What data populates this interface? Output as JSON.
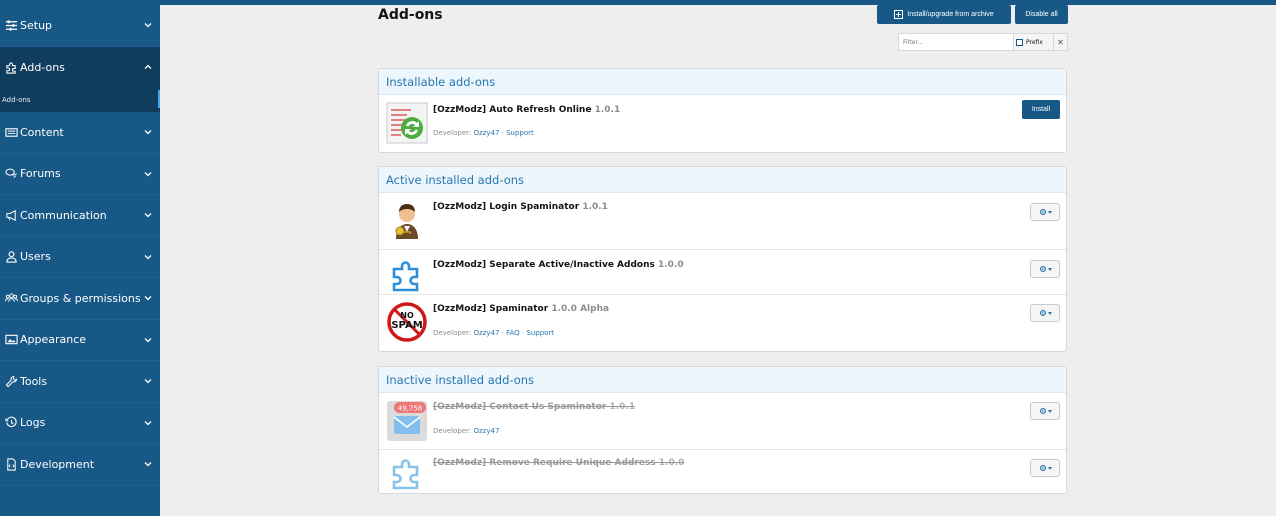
{
  "sidebar": {
    "items": [
      {
        "label": "Setup",
        "icon": "sliders-icon"
      },
      {
        "label": "Add-ons",
        "icon": "puzzle-icon"
      },
      {
        "label": "Content",
        "icon": "content-icon"
      },
      {
        "label": "Forums",
        "icon": "comments-icon"
      },
      {
        "label": "Communication",
        "icon": "megaphone-icon"
      },
      {
        "label": "Users",
        "icon": "user-icon"
      },
      {
        "label": "Groups & permissions",
        "icon": "users-icon"
      },
      {
        "label": "Appearance",
        "icon": "image-icon"
      },
      {
        "label": "Tools",
        "icon": "wrench-icon"
      },
      {
        "label": "Logs",
        "icon": "history-icon"
      },
      {
        "label": "Development",
        "icon": "file-code-icon"
      }
    ],
    "active_sub_item": "Add-ons"
  },
  "page": {
    "title": "Add-ons",
    "install_upgrade_label": "Install/upgrade from archive",
    "disable_all_label": "Disable all"
  },
  "filter": {
    "placeholder": "Filter...",
    "prefix_label": "Prefix",
    "clear_label": "✕"
  },
  "blocks": {
    "installable": {
      "header": "Installable add-ons",
      "addons": [
        {
          "title": "[OzzModz] Auto Refresh Online",
          "version": "1.0.1",
          "developer_label": "Developer:",
          "developer": "Ozzy47",
          "sep": "·",
          "support": "Support",
          "install_label": "Install"
        }
      ]
    },
    "active": {
      "header": "Active installed add-ons",
      "addons": [
        {
          "title": "[OzzModz] Login Spaminator",
          "version": "1.0.1"
        },
        {
          "title": "[OzzModz] Separate Active/Inactive Addons",
          "version": "1.0.0"
        },
        {
          "title": "[OzzModz] Spaminator",
          "version": "1.0.0 Alpha",
          "developer_label": "Developer:",
          "developer": "Ozzy47",
          "sep1": "·",
          "faq": "FAQ",
          "sep2": "·",
          "support": "Support"
        }
      ]
    },
    "inactive": {
      "header": "Inactive installed add-ons",
      "addons": [
        {
          "title": "[OzzModz] Contact Us Spaminator",
          "version": "1.0.1",
          "developer_label": "Developer:",
          "developer": "Ozzy47",
          "badge": "49,758"
        },
        {
          "title": "[OzzModz] Remove Require Unique Address",
          "version": "1.0.0"
        }
      ]
    }
  },
  "icons": {
    "nospam_top": "NO",
    "nospam_mid": "SPAM"
  },
  "colors": {
    "sidebar": "#185886",
    "sidebar_active": "#103c5e",
    "accent": "#2577b1",
    "header_bg": "#edf6fd"
  }
}
